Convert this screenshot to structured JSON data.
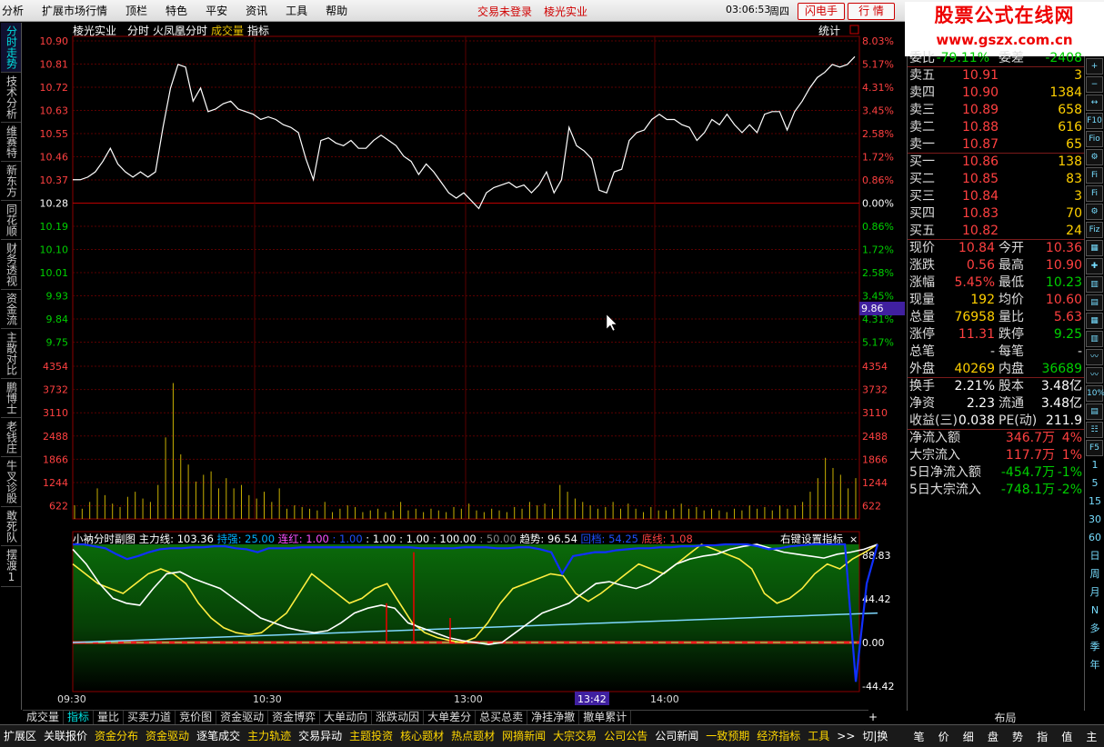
{
  "menubar": {
    "items": [
      "分析",
      "扩展市场行情",
      "顶栏",
      "特色",
      "平安",
      "资讯",
      "工具",
      "帮助"
    ],
    "status": "交易未登录",
    "stock": "棱光实业",
    "clock": "03:06:53",
    "weekday": "周四",
    "btn_flash": "闪电手",
    "btn_quote": "行  情"
  },
  "logo": {
    "line1": "股票公式在线网",
    "line2": "www.gszx.com.cn"
  },
  "left_tabs": [
    "分时走势",
    "技术分析",
    "维赛特",
    "新东方",
    "同花顺",
    "财务透视",
    "资金流",
    "主散对比",
    "鹏博士",
    "老钱庄",
    "牛叉诊股",
    "敢死队",
    "摆渡1"
  ],
  "chart": {
    "header": {
      "name": "棱光实业",
      "mode": "分时",
      "indicator_name": "火凤凰分时",
      "volume_label": "成交量",
      "indicator_label": "指标",
      "stats_label": "统计"
    },
    "price_labels": [
      "10.90",
      "10.81",
      "10.72",
      "10.63",
      "10.55",
      "10.46",
      "10.37",
      "10.28",
      "10.19",
      "10.10",
      "10.01",
      "9.93",
      "9.84",
      "9.75"
    ],
    "pct_labels": [
      "8.03%",
      "5.17%",
      "4.31%",
      "3.45%",
      "2.58%",
      "1.72%",
      "0.86%",
      "0.00%",
      "0.86%",
      "1.72%",
      "2.58%",
      "3.45%",
      "4.31%",
      "5.17%"
    ],
    "cursor_price": "9.86",
    "volume_labels": [
      "4354",
      "3732",
      "3110",
      "2488",
      "1866",
      "1244",
      "622"
    ],
    "price_series": [
      10.37,
      10.37,
      10.38,
      10.4,
      10.44,
      10.49,
      10.43,
      10.4,
      10.38,
      10.4,
      10.38,
      10.4,
      10.57,
      10.72,
      10.81,
      10.8,
      10.67,
      10.72,
      10.63,
      10.64,
      10.66,
      10.67,
      10.64,
      10.63,
      10.62,
      10.6,
      10.61,
      10.6,
      10.58,
      10.57,
      10.55,
      10.45,
      10.37,
      10.52,
      10.53,
      10.51,
      10.5,
      10.52,
      10.49,
      10.49,
      10.52,
      10.54,
      10.52,
      10.5,
      10.46,
      10.44,
      10.39,
      10.43,
      10.4,
      10.36,
      10.32,
      10.3,
      10.32,
      10.29,
      10.26,
      10.32,
      10.34,
      10.35,
      10.36,
      10.34,
      10.35,
      10.32,
      10.35,
      10.4,
      10.32,
      10.37,
      10.57,
      10.5,
      10.48,
      10.45,
      10.33,
      10.32,
      10.4,
      10.41,
      10.52,
      10.55,
      10.56,
      10.6,
      10.62,
      10.6,
      10.6,
      10.58,
      10.57,
      10.52,
      10.55,
      10.6,
      10.58,
      10.62,
      10.58,
      10.55,
      10.58,
      10.55,
      10.62,
      10.63,
      10.63,
      10.56,
      10.63,
      10.67,
      10.72,
      10.76,
      10.78,
      10.81,
      10.8,
      10.81,
      10.84
    ],
    "volume_series": [
      400,
      300,
      500,
      900,
      700,
      450,
      350,
      650,
      800,
      600,
      500,
      1000,
      2400,
      4000,
      1900,
      1600,
      1100,
      1300,
      1400,
      900,
      1200,
      900,
      1000,
      700,
      600,
      800,
      500,
      900,
      300,
      400,
      350,
      300,
      250,
      500,
      200,
      300,
      400,
      350,
      200,
      250,
      300,
      200,
      250,
      500,
      250,
      300,
      200,
      300,
      250,
      200,
      350,
      300,
      450,
      250,
      200,
      300,
      250,
      200,
      350,
      300,
      500,
      400,
      450,
      300,
      1000,
      800,
      600,
      500,
      400,
      300,
      350,
      500,
      300,
      450,
      300,
      200,
      350,
      250,
      250,
      300,
      450,
      300,
      350,
      250,
      300,
      250,
      200,
      300,
      250,
      400,
      300,
      350,
      250,
      400,
      300,
      400,
      500,
      800,
      1200,
      1800,
      1500,
      1300,
      900,
      1200
    ],
    "sub": {
      "title": "小衲分时副图",
      "main_label": "主力线:",
      "main_val": "103.36",
      "hold_label": "持强:",
      "hold_val": "25.00",
      "red_label": "连红:",
      "red_val": "1.00",
      "v1": ": 1.00",
      "v2": ": 1.00",
      "v3": ": 1.00",
      "v4": ": 100.00",
      "v5": ": 50.00",
      "trend_label": "趋势:",
      "trend_val": "96.54",
      "bg_label": "回档:",
      "bg_val": "54.25",
      "bottom_label": "底线:",
      "bottom_val": "1.08",
      "right_label": "右键设置指标",
      "axis": [
        "88.83",
        "44.42",
        "0.00",
        "-44.42"
      ],
      "blue": [
        100,
        100,
        98,
        96,
        90,
        85,
        88,
        92,
        95,
        96,
        96,
        97,
        97,
        98,
        98,
        96,
        95,
        92,
        96,
        96,
        96,
        97,
        97,
        97,
        97,
        97,
        97,
        97,
        97,
        97,
        97,
        97,
        96,
        96,
        96,
        96,
        97,
        97,
        97,
        96,
        96,
        97,
        97,
        95,
        92,
        70,
        88,
        90,
        92,
        92,
        94,
        95,
        96,
        96,
        97,
        97,
        98,
        98,
        99,
        99,
        100,
        100,
        100,
        98,
        95,
        96,
        98,
        99,
        100,
        100,
        100,
        100,
        -40,
        60,
        100
      ],
      "white": [
        95,
        80,
        60,
        45,
        40,
        38,
        55,
        70,
        72,
        65,
        60,
        55,
        45,
        35,
        25,
        20,
        15,
        12,
        10,
        12,
        20,
        30,
        35,
        38,
        35,
        20,
        15,
        10,
        5,
        2,
        0,
        -2,
        0,
        10,
        20,
        30,
        35,
        40,
        50,
        60,
        62,
        58,
        55,
        60,
        70,
        80,
        85,
        88,
        90,
        95,
        98,
        100,
        96,
        92,
        90,
        88,
        86,
        90,
        92,
        95,
        100
      ],
      "yellow": [
        80,
        70,
        60,
        55,
        50,
        60,
        70,
        75,
        70,
        60,
        40,
        25,
        15,
        10,
        8,
        10,
        20,
        30,
        50,
        70,
        60,
        50,
        40,
        45,
        55,
        60,
        40,
        20,
        10,
        5,
        2,
        0,
        5,
        20,
        40,
        55,
        60,
        65,
        70,
        68,
        50,
        42,
        50,
        60,
        70,
        80,
        75,
        70,
        80,
        90,
        100,
        95,
        90,
        85,
        75,
        50,
        40,
        45,
        55,
        70,
        80,
        75,
        85,
        92,
        100
      ],
      "lightblue": [
        0,
        2,
        4,
        6,
        8,
        10,
        12,
        14,
        16,
        18,
        20,
        22,
        24,
        26,
        28,
        30
      ]
    }
  },
  "time_labels": [
    "09:30",
    "10:30",
    "13:00",
    "13:42",
    "14:00"
  ],
  "layout_label": "布局",
  "quote": {
    "wei_label": "委比",
    "wei_val": "-79.11%",
    "weicha_label": "委差",
    "weicha_val": "-2408",
    "sells": [
      [
        "卖五",
        "10.91",
        "3"
      ],
      [
        "卖四",
        "10.90",
        "1384"
      ],
      [
        "卖三",
        "10.89",
        "658"
      ],
      [
        "卖二",
        "10.88",
        "616"
      ],
      [
        "卖一",
        "10.87",
        "65"
      ]
    ],
    "buys": [
      [
        "买一",
        "10.86",
        "138"
      ],
      [
        "买二",
        "10.85",
        "83"
      ],
      [
        "买三",
        "10.84",
        "3"
      ],
      [
        "买四",
        "10.83",
        "70"
      ],
      [
        "买五",
        "10.82",
        "24"
      ]
    ],
    "stats": [
      [
        "现价",
        "10.84",
        "今开",
        "10.36"
      ],
      [
        "涨跌",
        "0.56",
        "最高",
        "10.90"
      ],
      [
        "涨幅",
        "5.45%",
        "最低",
        "10.23"
      ],
      [
        "现量",
        "192",
        "均价",
        "10.60"
      ],
      [
        "总量",
        "76958",
        "量比",
        "5.63"
      ],
      [
        "涨停",
        "11.31",
        "跌停",
        "9.25"
      ],
      [
        "总笔",
        "-",
        "每笔",
        "-"
      ],
      [
        "外盘",
        "40269",
        "内盘",
        "36689"
      ]
    ],
    "stats2": [
      [
        "换手",
        "2.21%",
        "股本",
        "3.48亿"
      ],
      [
        "净资",
        "2.23",
        "流通",
        "3.48亿"
      ],
      [
        "收益(三)",
        "0.038",
        "PE(动)",
        "211.9"
      ]
    ],
    "flows": [
      [
        "净流入额",
        "346.7万",
        "4%"
      ],
      [
        "大宗流入",
        "117.7万",
        "1%"
      ],
      [
        "5日净流入额",
        "-454.7万",
        "-1%"
      ],
      [
        "5日大宗流入",
        "-748.1万",
        "-2%"
      ]
    ]
  },
  "right_icons": [
    "+",
    "−",
    "↔",
    "F10",
    "Fio",
    "⚙",
    "Fi",
    "Fi",
    "⚙",
    "Fiz",
    "▦",
    "✚",
    "▥",
    "▤",
    "▦",
    "▥",
    "〰",
    "〰",
    "10%",
    "▤",
    "☷",
    "F5"
  ],
  "right_nums": [
    "1",
    "5",
    "15",
    "30",
    "60",
    "日",
    "周",
    "月",
    "N",
    "多",
    "季",
    "年"
  ],
  "bottom_tabs1": [
    "成交量",
    "指标",
    "量比",
    "买卖力道",
    "竞价图",
    "资金驱动",
    "资金博弈",
    "大单动向",
    "涨跌动因",
    "大单差分",
    "总买总卖",
    "净挂净撤",
    "撤单累计"
  ],
  "bottom_tabs1_active": 1,
  "bottom_tabs2": [
    "扩展区",
    "关联报价",
    "资金分布",
    "资金驱动",
    "逐笔成交",
    "主力轨迹",
    "交易异动",
    "主题投资",
    "核心题材",
    "热点题材",
    "网摘新闻",
    "大宗交易",
    "公司公告",
    "公司新闻",
    "一致预期",
    "经济指标",
    "工具",
    ">>",
    "切|换"
  ],
  "bottom_right_tabs": [
    "笔",
    "价",
    "细",
    "盘",
    "势",
    "指",
    "值",
    "主"
  ],
  "bottom_nav": [
    "+",
    "−",
    "↓"
  ]
}
